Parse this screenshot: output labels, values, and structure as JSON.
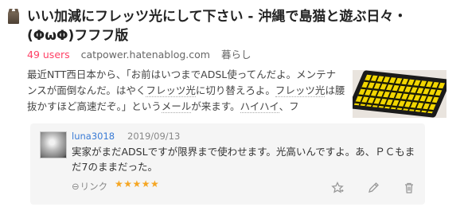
{
  "entry": {
    "title": "いい加減にフレッツ光にして下さい - 沖縄で島猫と遊ぶ日々・(ΦωΦ)フフフ版",
    "users": "49 users",
    "domain": "catpower.hatenablog.com",
    "category": "暮らし",
    "summary": {
      "p1": "最近NTT西日本から、「お前はいつまでADSL使ってんだよ。メンテナンスが面倒なんだ。はやく",
      "kw1": "フレッツ光",
      "p2": "に切り替えろよ。",
      "kw2": "フレッツ光",
      "p3": "は腰抜かすほど高速だぞ。」という",
      "kw3": "メール",
      "p4": "が来ます。",
      "kw4": "ハイハイ",
      "p5": "、フ"
    }
  },
  "comment": {
    "username": "luna3018",
    "date": "2019/09/13",
    "text": "実家がまだADSLですが限界まで使わせます。光高いんですよ。あ、ＰＣもまだ7のままだった。",
    "link_label": "リンク",
    "link_icon": "⊖",
    "stars": "★★★★★"
  },
  "colors": {
    "users": "#ff4166",
    "username": "#3a7bd5",
    "stars": "#f5a623"
  },
  "icons": {
    "favicon": "cat-favicon-icon",
    "add_star": "star-outline-icon",
    "edit": "pencil-icon",
    "delete": "trash-icon"
  }
}
